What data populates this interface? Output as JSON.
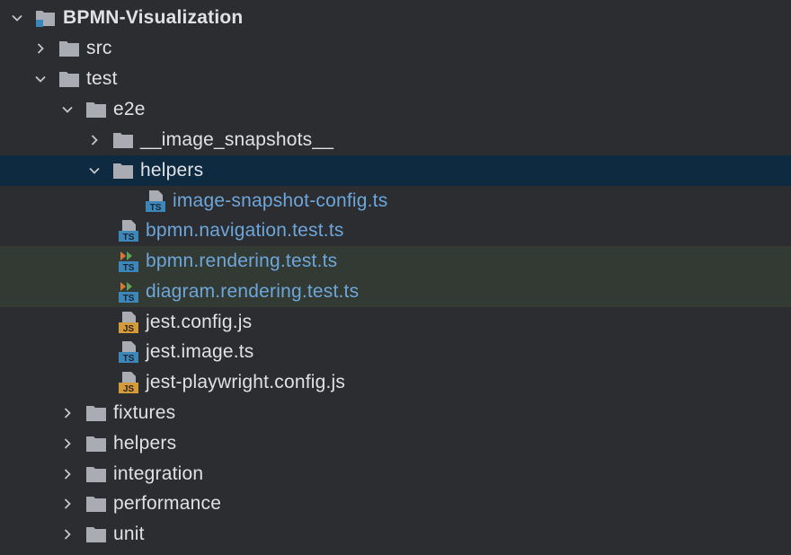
{
  "colors": {
    "background": "#2b2d30",
    "selected_row": "#0d2a40",
    "modified_row": "#323a33",
    "ts_file_text": "#6ea6da",
    "folder": "#a9adb3",
    "ts_badge": "#3d87b8",
    "js_badge": "#d39b3a"
  },
  "tree": {
    "root": {
      "label": "BPMN-Visualization",
      "expanded": true,
      "icon": "module-folder-icon"
    },
    "items": [
      {
        "label": "src",
        "type": "folder",
        "expanded": false
      },
      {
        "label": "test",
        "type": "folder",
        "expanded": true
      },
      {
        "label": "e2e",
        "type": "folder",
        "expanded": true
      },
      {
        "label": "__image_snapshots__",
        "type": "folder",
        "expanded": false
      },
      {
        "label": "helpers",
        "type": "folder",
        "expanded": true,
        "selected": true
      },
      {
        "label": "image-snapshot-config.ts",
        "type": "ts-file"
      },
      {
        "label": "bpmn.navigation.test.ts",
        "type": "ts-file"
      },
      {
        "label": "bpmn.rendering.test.ts",
        "type": "ts-test-file",
        "modified": true
      },
      {
        "label": "diagram.rendering.test.ts",
        "type": "ts-test-file",
        "modified": true
      },
      {
        "label": "jest.config.js",
        "type": "js-file"
      },
      {
        "label": "jest.image.ts",
        "type": "ts-file"
      },
      {
        "label": "jest-playwright.config.js",
        "type": "js-file"
      },
      {
        "label": "fixtures",
        "type": "folder",
        "expanded": false
      },
      {
        "label": "helpers",
        "type": "folder",
        "expanded": false
      },
      {
        "label": "integration",
        "type": "folder",
        "expanded": false
      },
      {
        "label": "performance",
        "type": "folder",
        "expanded": false
      },
      {
        "label": "unit",
        "type": "folder",
        "expanded": false
      }
    ],
    "badges": {
      "ts": "TS",
      "js": "JS"
    }
  }
}
